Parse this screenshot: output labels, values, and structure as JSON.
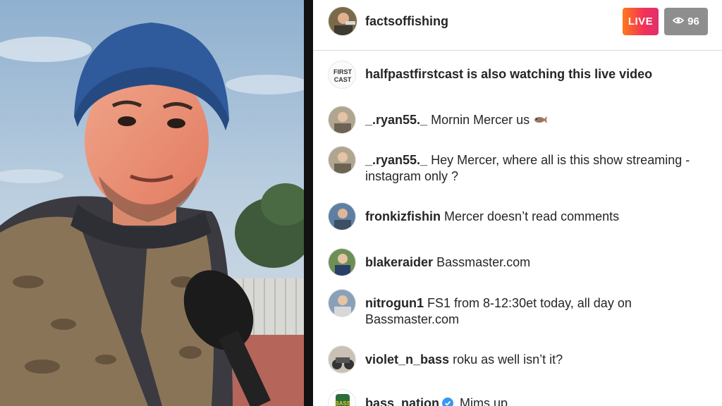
{
  "header": {
    "host_username": "factsoffishing",
    "live_label": "LIVE",
    "viewer_count": "96",
    "viewer_icon": "eye-icon"
  },
  "notice": {
    "username": "halfpastfirstcast",
    "text": "is also watching this live video",
    "avatar_text": "FIRST CAST"
  },
  "comments": [
    {
      "username": "_.ryan55._",
      "text": "Mornin Mercer us",
      "emoji": "fish-emoji"
    },
    {
      "username": "_.ryan55._",
      "text": "Hey Mercer, where all is this show streaming - instagram only ?"
    },
    {
      "username": "fronkizfishin",
      "text": "Mercer doesn’t read comments"
    },
    {
      "username": "blakeraider",
      "text": "Bassmaster.com"
    },
    {
      "username": "nitrogun1",
      "text": "FS1 from 8-12:30et today, all day on Bassmaster.com"
    },
    {
      "username": "violet_n_bass",
      "text": "roku as well isn’t it?"
    },
    {
      "username": "bass_nation",
      "text": "Mims up",
      "verified": true
    }
  ],
  "colors": {
    "live_gradient_start": "#ff7a1a",
    "live_gradient_end": "#e1306c",
    "viewer_badge": "#8e8e8e",
    "verified": "#3897f0"
  }
}
